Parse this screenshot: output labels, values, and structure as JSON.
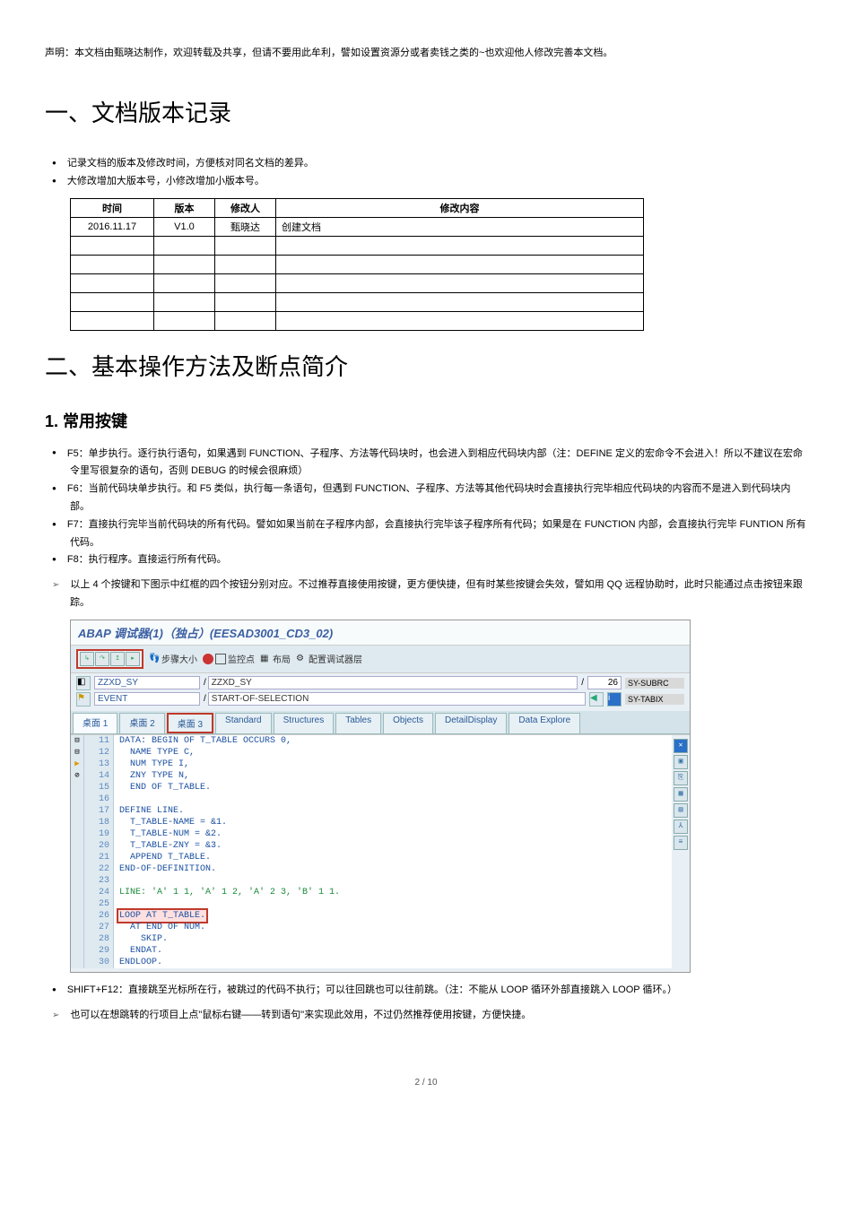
{
  "disclaimer": "声明：本文档由甄晓达制作，欢迎转载及共享，但请不要用此牟利，譬如设置资源分或者卖钱之类的~也欢迎他人修改完善本文档。",
  "h1_1": "一、文档版本记录",
  "notes1": [
    "记录文档的版本及修改时间，方便核对同名文档的差异。",
    "大修改增加大版本号，小修改增加小版本号。"
  ],
  "version_table": {
    "headers": [
      "时间",
      "版本",
      "修改人",
      "修改内容"
    ],
    "rows": [
      [
        "2016.11.17",
        "V1.0",
        "甄晓达",
        "创建文档"
      ],
      [
        "",
        "",
        "",
        ""
      ],
      [
        "",
        "",
        "",
        ""
      ],
      [
        "",
        "",
        "",
        ""
      ],
      [
        "",
        "",
        "",
        ""
      ],
      [
        "",
        "",
        "",
        ""
      ]
    ]
  },
  "h1_2": "二、基本操作方法及断点简介",
  "h2_1": "1. 常用按键",
  "keys_bullets": [
    "F5：单步执行。逐行执行语句，如果遇到 FUNCTION、子程序、方法等代码块时，也会进入到相应代码块内部（注：DEFINE 定义的宏命令不会进入！所以不建议在宏命令里写很复杂的语句，否则 DEBUG 的时候会很麻烦）",
    "F6：当前代码块单步执行。和 F5 类似，执行每一条语句，但遇到 FUNCTION、子程序、方法等其他代码块时会直接执行完毕相应代码块的内容而不是进入到代码块内部。",
    "F7：直接执行完毕当前代码块的所有代码。譬如如果当前在子程序内部，会直接执行完毕该子程序所有代码；如果是在 FUNCTION 内部，会直接执行完毕 FUNTION 所有代码。",
    "F8：执行程序。直接运行所有代码。"
  ],
  "keys_arrow": "以上 4 个按键和下图示中红框的四个按钮分别对应。不过推荐直接使用按键，更方便快捷，但有时某些按键会失效，譬如用 QQ 远程协助时，此时只能通过点击按钮来跟踪。",
  "debugger": {
    "title": "ABAP 调试器(1)（独占）(EESAD3001_CD3_02)",
    "toolbar": {
      "stepsize": "步骤大小",
      "watch": "监控点",
      "layout": "布局",
      "config": "配置调试器层"
    },
    "field1": {
      "label": "ZZXD_SY",
      "mid_prefix": "/",
      "mid": "ZZXD_SY",
      "slash": "/",
      "right": "26",
      "sy": "SY-SUBRC"
    },
    "field2": {
      "label": "EVENT",
      "mid_prefix": "/",
      "mid": "START-OF-SELECTION",
      "sy": "SY-TABIX"
    },
    "tabs": [
      "桌面 1",
      "桌面 2",
      "桌面 3",
      "Standard",
      "Structures",
      "Tables",
      "Objects",
      "DetailDisplay",
      "Data Explore"
    ],
    "code": {
      "lines": [
        {
          "n": 11,
          "t": "DATA: BEGIN OF T_TABLE OCCURS 0,",
          "m": "⊟",
          "cls": "kw"
        },
        {
          "n": 12,
          "t": "  NAME TYPE C,",
          "cls": "kw"
        },
        {
          "n": 13,
          "t": "  NUM TYPE I,",
          "cls": "kw"
        },
        {
          "n": 14,
          "t": "  ZNY TYPE N,",
          "cls": "kw"
        },
        {
          "n": 15,
          "t": "  END OF T_TABLE.",
          "cls": "kw"
        },
        {
          "n": 16,
          "t": ""
        },
        {
          "n": 17,
          "t": "DEFINE LINE.",
          "m": "⊟",
          "cls": "kw"
        },
        {
          "n": 18,
          "t": "  T_TABLE-NAME = &1.",
          "cls": "kw"
        },
        {
          "n": 19,
          "t": "  T_TABLE-NUM = &2.",
          "cls": "kw"
        },
        {
          "n": 20,
          "t": "  T_TABLE-ZNY = &3.",
          "cls": "kw"
        },
        {
          "n": 21,
          "t": "  APPEND T_TABLE.",
          "cls": "kw"
        },
        {
          "n": 22,
          "t": "END-OF-DEFINITION.",
          "cls": "kw"
        },
        {
          "n": 23,
          "t": ""
        },
        {
          "n": 24,
          "t": "LINE: 'A' 1 1, 'A' 1 2, 'A' 2 3, 'B' 1 1.",
          "cls": "str"
        },
        {
          "n": 25,
          "t": ""
        },
        {
          "n": 26,
          "t": "LOOP AT T_TABLE.",
          "m": "⊟",
          "cls": "kw",
          "hl": true,
          "cursor": true
        },
        {
          "n": 27,
          "t": "  AT END OF NUM.",
          "m": "⊘",
          "cls": "kw"
        },
        {
          "n": 28,
          "t": "    SKIP.",
          "cls": "kw"
        },
        {
          "n": 29,
          "t": "  ENDAT.",
          "cls": "kw"
        },
        {
          "n": 30,
          "t": "ENDLOOP.",
          "cls": "kw"
        }
      ]
    },
    "side_icons": [
      "✕",
      "▣",
      "⎘",
      "▦",
      "▤",
      "⅄",
      "≡"
    ]
  },
  "shift_bullet": "SHIFT+F12：直接跳至光标所在行，被跳过的代码不执行；可以往回跳也可以往前跳。（注：不能从 LOOP 循环外部直接跳入 LOOP 循环。）",
  "shift_arrow": "也可以在想跳转的行项目上点\"鼠标右键——转到语句\"来实现此效用，不过仍然推荐使用按键，方便快捷。",
  "footer": "2 / 10"
}
